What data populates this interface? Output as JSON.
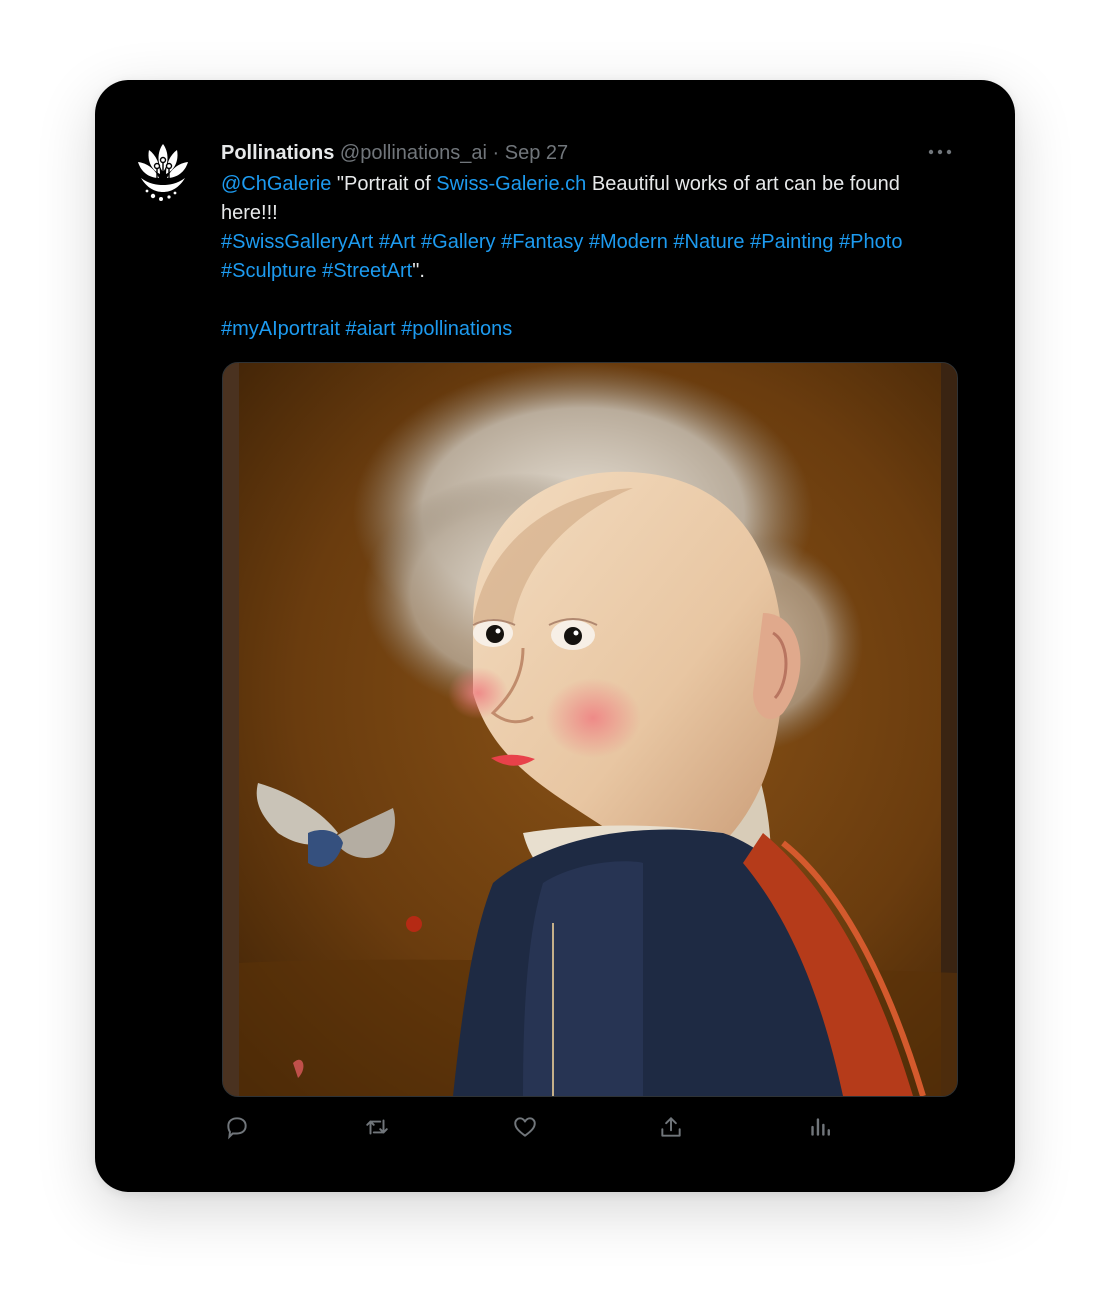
{
  "tweet": {
    "author_name": "Pollinations",
    "handle": "@pollinations_ai",
    "separator": "·",
    "date": "Sep 27",
    "mention": "@ChGalerie",
    "quote_open": " \"Portrait of ",
    "site_link": "Swiss-Galerie.ch",
    "sentence": " Beautiful works of art can be found here!!!",
    "hashtags_line": "#SwissGalleryArt #Art #Gallery #Fantasy #Modern #Nature #Painting #Photo #Sculpture #StreetArt",
    "quote_close": "\".",
    "tags_line": "#myAIportrait #aiart #pollinations"
  },
  "icons": {
    "avatar": "pollinations-logo",
    "more": "more-dots-icon",
    "reply": "reply-icon",
    "retweet": "retweet-icon",
    "like": "heart-icon",
    "share": "share-icon",
    "analytics": "analytics-icon"
  },
  "colors": {
    "background": "#000000",
    "text": "#e7e9ea",
    "muted": "#71767b",
    "link": "#1d9bf0"
  },
  "media": {
    "type": "image",
    "subject": "portrait-painting"
  }
}
